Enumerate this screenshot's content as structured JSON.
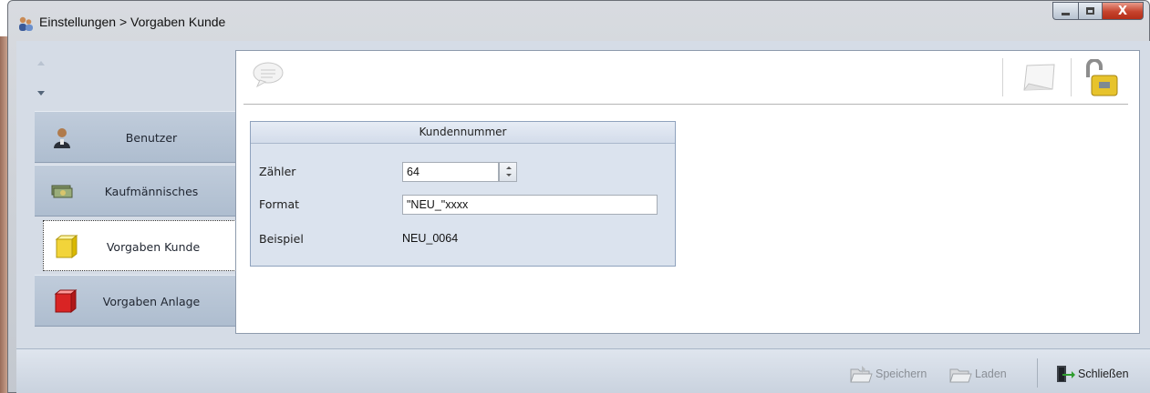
{
  "window": {
    "title": "Einstellungen > Vorgaben Kunde",
    "close_glyph": "X"
  },
  "nav": {
    "items": [
      {
        "label": "Benutzer",
        "icon": "user-icon"
      },
      {
        "label": "Kaufmännisches",
        "icon": "money-icon"
      },
      {
        "label": "Vorgaben Kunde",
        "icon": "yellow-cube-icon",
        "active": true
      },
      {
        "label": "Vorgaben Anlage",
        "icon": "red-cube-icon"
      }
    ]
  },
  "group": {
    "title": "Kundennummer",
    "rows": {
      "counter_label": "Zähler",
      "counter_value": "64",
      "format_label": "Format",
      "format_value": "\"NEU_\"xxxx",
      "example_label": "Beispiel",
      "example_value": "NEU_0064"
    }
  },
  "statusbar": {
    "save": "Speichern",
    "load": "Laden",
    "close": "Schließen"
  },
  "colors": {
    "client_bg": "#d5dce6",
    "nav_item_bg": "#b6c4d5",
    "group_bg": "#dbe3ee",
    "close_button": "#c6432d"
  }
}
